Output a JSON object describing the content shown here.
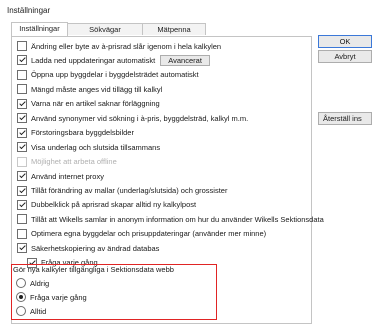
{
  "window": {
    "title": "Inställningar"
  },
  "tabs": [
    {
      "label": "Inställningar",
      "active": true
    },
    {
      "label": "Sökvägar",
      "active": false
    },
    {
      "label": "Mätpenna",
      "active": false
    }
  ],
  "options": [
    {
      "label": "Ändring eller byte av à-prisrad slår igenom i hela kalkylen",
      "checked": false,
      "disabled": false
    },
    {
      "label": "Ladda ned uppdateringar automatiskt",
      "checked": true,
      "disabled": false,
      "button": "Avancerat"
    },
    {
      "label": "Öppna upp byggdelar i byggdelsträdet automatiskt",
      "checked": false,
      "disabled": false
    },
    {
      "label": "Mängd måste anges vid tillägg till kalkyl",
      "checked": false,
      "disabled": false
    },
    {
      "label": "Varna när en artikel saknar förläggning",
      "checked": true,
      "disabled": false
    },
    {
      "label": "Använd synonymer vid sökning i à-pris, byggdelsträd, kalkyl m.m.",
      "checked": true,
      "disabled": false
    },
    {
      "label": "Förstoringsbara byggdelsbilder",
      "checked": true,
      "disabled": false
    },
    {
      "label": "Visa underlag och slutsida tillsammans",
      "checked": true,
      "disabled": false
    },
    {
      "label": "Möjlighet att arbeta offline",
      "checked": false,
      "disabled": true
    },
    {
      "label": "Använd internet proxy",
      "checked": true,
      "disabled": false
    },
    {
      "label": "Tillåt förändring av mallar (underlag/slutsida) och grossister",
      "checked": true,
      "disabled": false
    },
    {
      "label": "Dubbelklick på aprisrad skapar alltid ny kalkylpost",
      "checked": true,
      "disabled": false
    },
    {
      "label": "Tillåt att Wikells samlar in anonym information om hur du använder Wikells Sektionsdata",
      "checked": false,
      "disabled": false
    },
    {
      "label": "Optimera egna byggdelar och prisuppdateringar (använder mer minne)",
      "checked": false,
      "disabled": false
    },
    {
      "label": "Säkerhetskopiering av ändrad databas",
      "checked": true,
      "disabled": false
    }
  ],
  "sub_option": {
    "label": "Fråga varje gång",
    "checked": true
  },
  "share_group": {
    "title": "Gör nya kalkyler tillgängliga i Sektionsdata webb",
    "options": [
      {
        "label": "Aldrig",
        "selected": false
      },
      {
        "label": "Fråga varje gång",
        "selected": true
      },
      {
        "label": "Alltid",
        "selected": false
      }
    ]
  },
  "buttons": {
    "ok": "OK",
    "cancel": "Avbryt",
    "reset": "Återställ ins"
  }
}
